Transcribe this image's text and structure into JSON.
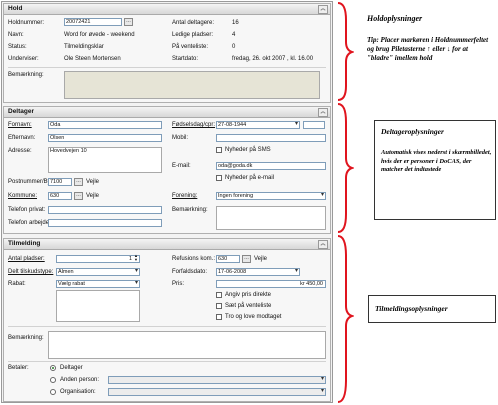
{
  "hold": {
    "title": "Hold",
    "holdnummer_label": "Holdnummer:",
    "holdnummer_value": "20072421",
    "navn_label": "Navn:",
    "navn_value": "Word for øvede - weekend",
    "status_label": "Status:",
    "status_value": "Tilmeldingsklar",
    "underviser_label": "Underviser:",
    "underviser_value": "Ole Steen Mortensen",
    "antal_deltagere_label": "Antal deltagere:",
    "antal_deltagere_value": "16",
    "ledige_pladser_label": "Ledige pladser:",
    "ledige_pladser_value": "4",
    "paa_venteliste_label": "På venteliste:",
    "paa_venteliste_value": "0",
    "startdato_label": "Startdato:",
    "startdato_value": "fredag, 26. okt 2007 , kl. 16.00",
    "bemaerkning_label": "Bemærkning:"
  },
  "deltager": {
    "title": "Deltager",
    "fornavn_label": "Fornavn:",
    "fornavn_value": "Oda",
    "efternavn_label": "Efternavn:",
    "efternavn_value": "Olsen",
    "adresse_label": "Adresse:",
    "adresse_value": "Hovedvejen 10",
    "postnummer_label": "Postnummer/By:",
    "postnummer_value": "7100",
    "by_value": "Vejle",
    "kommune_label": "Kommune:",
    "kommune_value": "630",
    "kommune_by": "Vejle",
    "telefon_privat_label": "Telefon privat:",
    "telefon_arbejde_label": "Telefon arbejde:",
    "foedselsdag_label": "Fødselsdag/cpr:",
    "foedselsdag_value": "27-08-1944",
    "mobil_label": "Mobil:",
    "nyheder_sms_label": "Nyheder på SMS",
    "email_label": "E-mail:",
    "email_value": "oda@goda.dk",
    "nyheder_email_label": "Nyheder på e-mail",
    "forening_label": "Forening:",
    "forening_value": "Ingen forening",
    "bemaerkning_label": "Bemærkning:"
  },
  "tilmelding": {
    "title": "Tilmelding",
    "antal_pladser_label": "Antal pladser:",
    "antal_pladser_value": "1",
    "delt_tilskud_label": "Delt tilskudstype:",
    "delt_tilskud_value": "Almen",
    "rabat_label": "Rabat:",
    "rabat_value": "Vælg rabat",
    "refusions_label": "Refusions kom.:",
    "refusions_value": "630",
    "refusions_by": "Vejle",
    "forfaldsdato_label": "Forfaldsdato:",
    "forfaldsdato_value": "17-06-2008",
    "pris_label": "Pris:",
    "pris_value": "kr 450,00",
    "angiv_pris_label": "Angiv pris direkte",
    "saet_venteliste_label": "Sæt på venteliste",
    "tro_og_love_label": "Tro og love modtaget",
    "bemaerkning_label": "Bemærkning:",
    "betaler_label": "Betaler:",
    "deltager_option": "Deltager",
    "anden_person_option": "Anden person:",
    "organisation_option": "Organisation:"
  },
  "annotations": {
    "hold_title": "Holdoplysninger",
    "hold_tip": "Tip: Placer markøren i Holdnummerfeltet og brug Piletasterne ↑ eller ↓ for at \"bladre\" imellem hold",
    "deltager_title": "Deltageroplysninger",
    "deltager_text": "Automatisk vises nederst i skærmbilledet, hvis der er personer i DoCAS, der matcher det indtastede",
    "tilmelding_title": "Tilmeldingsoplysninger"
  },
  "colors": {
    "brace": "#e0141e",
    "field_border": "#7f9db9",
    "section_bg": "#f7f7f7"
  }
}
